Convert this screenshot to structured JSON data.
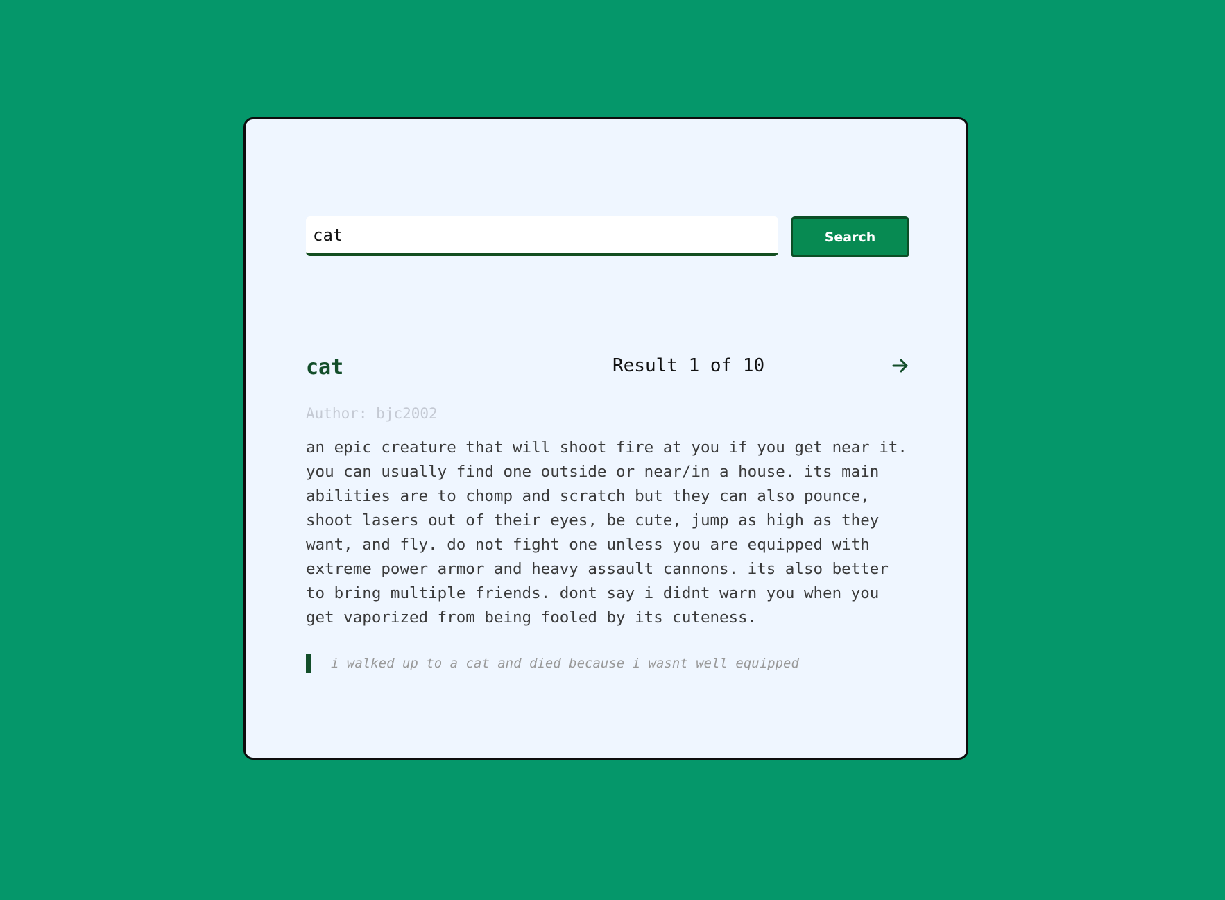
{
  "search": {
    "value": "cat",
    "button_label": "Search"
  },
  "result": {
    "word": "cat",
    "counter": "Result 1 of 10",
    "author_label": "Author:",
    "author": "bjc2002",
    "definition": "an epic creature that will shoot fire at you if you get near it. you can usually find one outside or near/in a house. its main abilities are to chomp and scratch but they can also pounce, shoot lasers out of their eyes, be cute, jump as high as they want, and fly. do not fight one unless you are equipped with extreme power armor and heavy assault cannons. its also better to bring multiple friends. dont say i didnt warn you when you get vaporized from being fooled by its cuteness.",
    "example": "i walked up to a cat and died because i wasnt well equipped",
    "next_icon": "arrow-right-icon"
  },
  "colors": {
    "page_background": "#05976a",
    "card_background": "#eff6ff",
    "accent": "#078a52",
    "title": "#134e2a"
  }
}
